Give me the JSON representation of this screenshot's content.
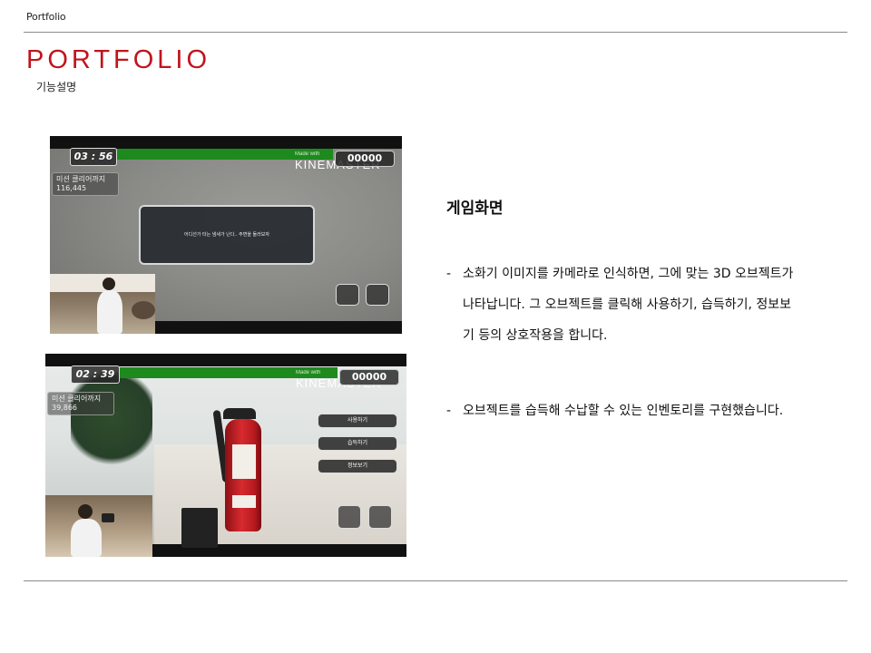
{
  "header": {
    "label": "Portfolio"
  },
  "title": "PORTFOLIO",
  "subtitle": "기능설명",
  "screenshot1": {
    "timer": "03 : 56",
    "score": "00000",
    "watermark_small": "Made with",
    "watermark": "KINEMASTER",
    "mission_label": "미션 클리어까지",
    "mission_value": "116,445",
    "dialog_text": "어디선가 타는 냄새가 난다.. 주변을 둘러보자"
  },
  "screenshot2": {
    "timer": "02 : 39",
    "score": "00000",
    "watermark_small": "Made with",
    "watermark": "KINEMASTER",
    "mission_label": "미션 클리어까지",
    "mission_value": "39,866",
    "menu": [
      "사용하기",
      "습득하기",
      "정보보기"
    ]
  },
  "section": {
    "heading": "게임화면",
    "bullets": [
      {
        "dash": "-",
        "lines": [
          "소화기 이미지를 카메라로 인식하면, 그에 맞는 3D 오브젝트가",
          "나타납니다. 그 오브젝트를 클릭해 사용하기, 습득하기, 정보보",
          "기 등의 상호작용을 합니다."
        ]
      },
      {
        "dash": "-",
        "lines": [
          "오브젝트를 습득해 수납할 수 있는 인벤토리를 구현했습니다."
        ]
      }
    ]
  },
  "colors": {
    "title_red": "#c0141c",
    "rule_gray": "#8a8a8a",
    "hp_green": "#1e8a1e"
  }
}
